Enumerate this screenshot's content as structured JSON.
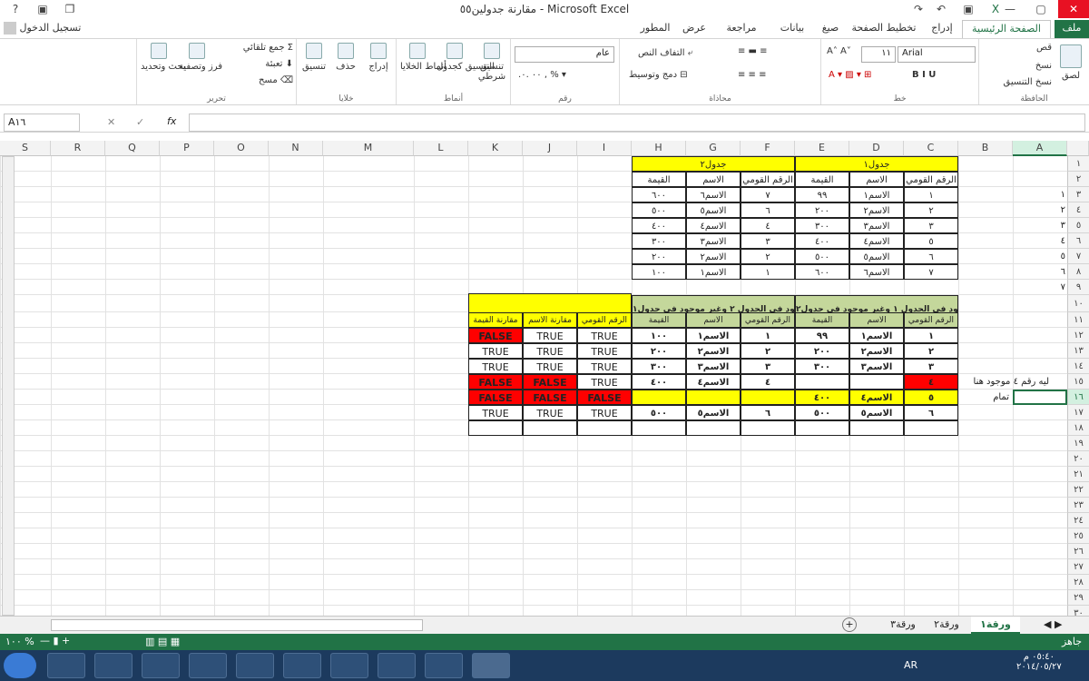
{
  "window": {
    "title": "مقارنة جدولين٥٥ - Microsoft Excel",
    "signin": "تسجيل الدخول"
  },
  "tabs": [
    "ملف",
    "الصفحة الرئيسية",
    "إدراج",
    "تخطيط الصفحة",
    "صيغ",
    "بيانات",
    "مراجعة",
    "عرض",
    "المطور"
  ],
  "ribbon": {
    "clipboard": {
      "label": "الحافظة",
      "paste": "لصق",
      "cut": "قص",
      "copy": "نسخ",
      "format_painter": "نسخ التنسيق"
    },
    "font": {
      "label": "خط",
      "name": "Arial",
      "size": "١١"
    },
    "alignment": {
      "label": "محاذاة",
      "wrap": "التفاف النص",
      "merge": "دمج وتوسيط"
    },
    "number": {
      "label": "رقم",
      "format": "عام"
    },
    "styles": {
      "label": "أنماط",
      "conditional": "تنسيق شرطي",
      "as_table": "التنسيق كجدول",
      "cell_styles": "أنماط الخلايا"
    },
    "cells": {
      "label": "خلايا",
      "insert": "إدراج",
      "delete": "حذف",
      "format": "تنسيق"
    },
    "editing": {
      "label": "تحرير",
      "autosum": "جمع تلقائي",
      "fill": "تعبئة",
      "clear": "مسح",
      "sort": "فرز وتصفية",
      "find": "بحث وتحديد"
    }
  },
  "formula_bar": {
    "name_box": "A١٦",
    "fx": "fx",
    "value": ""
  },
  "columns": [
    "A",
    "B",
    "C",
    "D",
    "E",
    "F",
    "G",
    "H",
    "I",
    "J",
    "K",
    "L",
    "M",
    "N",
    "O",
    "P",
    "Q",
    "R",
    "S"
  ],
  "rows": [
    "١",
    "٢",
    "٣",
    "٤",
    "٥",
    "٦",
    "٧",
    "٨",
    "٩",
    "١٠",
    "١١",
    "١٢",
    "١٣",
    "١٤",
    "١٥",
    "١٦",
    "١٧",
    "١٨",
    "١٩",
    "٢٠",
    "٢١",
    "٢٢",
    "٢٣",
    "٢٤",
    "٢٥",
    "٢٦",
    "٢٧",
    "٢٨",
    "٢٩",
    "٣٠"
  ],
  "table1": {
    "title": "جدول١",
    "headers": [
      "الرقم القومي",
      "الاسم",
      "القيمة"
    ],
    "rows": [
      [
        "١",
        "الاسم١",
        "٩٩"
      ],
      [
        "٢",
        "الاسم٢",
        "٢٠٠"
      ],
      [
        "٣",
        "الاسم٣",
        "٣٠٠"
      ],
      [
        "٥",
        "الاسم٤",
        "٤٠٠"
      ],
      [
        "٦",
        "الاسم٥",
        "٥٠٠"
      ],
      [
        "٧",
        "الاسم٦",
        "٦٠٠"
      ]
    ]
  },
  "table2": {
    "title": "جدول٢",
    "headers": [
      "الرقم القومي",
      "الاسم",
      "القيمة"
    ],
    "rows": [
      [
        "٧",
        "الاسم٦",
        "٦٠٠"
      ],
      [
        "٦",
        "الاسم٥",
        "٥٠٠"
      ],
      [
        "٤",
        "الاسم٤",
        "٤٠٠"
      ],
      [
        "٣",
        "الاسم٣",
        "٣٠٠"
      ],
      [
        "٢",
        "الاسم٢",
        "٢٠٠"
      ],
      [
        "١",
        "الاسم١",
        "١٠٠"
      ]
    ]
  },
  "colA_nums": [
    "١",
    "٢",
    "٣",
    "٤",
    "٥",
    "٦",
    "٧"
  ],
  "compare": {
    "head1": "الموجود في الجدول ١ وغير موجود في جدول٢",
    "head2": "الموجود في الجدول ٢ وغير موجود في جدول١",
    "sub": [
      "الرقم القومي",
      "الاسم",
      "القيمة",
      "الرقم القومي",
      "الاسم",
      "القيمة",
      "الرقم القومي",
      "مقارنة الاسم",
      "مقارنة القيمة"
    ],
    "rows": [
      [
        "١",
        "الاسم١",
        "٩٩",
        "١",
        "الاسم١",
        "١٠٠",
        "TRUE",
        "TRUE",
        "FALSE"
      ],
      [
        "٢",
        "الاسم٢",
        "٢٠٠",
        "٢",
        "الاسم٢",
        "٢٠٠",
        "TRUE",
        "TRUE",
        "TRUE"
      ],
      [
        "٣",
        "الاسم٣",
        "٣٠٠",
        "٣",
        "الاسم٣",
        "٣٠٠",
        "TRUE",
        "TRUE",
        "TRUE"
      ],
      [
        "٤",
        "",
        "",
        "٤",
        "الاسم٤",
        "٤٠٠",
        "TRUE",
        "FALSE",
        "FALSE"
      ],
      [
        "٥",
        "الاسم٤",
        "٤٠٠",
        "",
        "",
        "",
        "FALSE",
        "FALSE",
        "FALSE"
      ],
      [
        "٦",
        "الاسم٥",
        "٥٠٠",
        "٦",
        "الاسم٥",
        "٥٠٠",
        "TRUE",
        "TRUE",
        "TRUE"
      ]
    ]
  },
  "notes": {
    "b15": "ليه رقم ٤ موجود هنا",
    "b16": "تمام"
  },
  "sheets": [
    "ورقة١",
    "ورقة٢",
    "ورقة٣"
  ],
  "status": {
    "ready": "جاهز",
    "zoom": "١٠٠ %"
  },
  "taskbar": {
    "lang": "AR",
    "time": "٠٥:٤٠ م",
    "date": "٢٠١٤/٠٥/٢٧"
  },
  "colors": {
    "excel_green": "#217346",
    "yellow": "#ffff00",
    "green": "#c4d79b",
    "red": "#ff0000"
  }
}
